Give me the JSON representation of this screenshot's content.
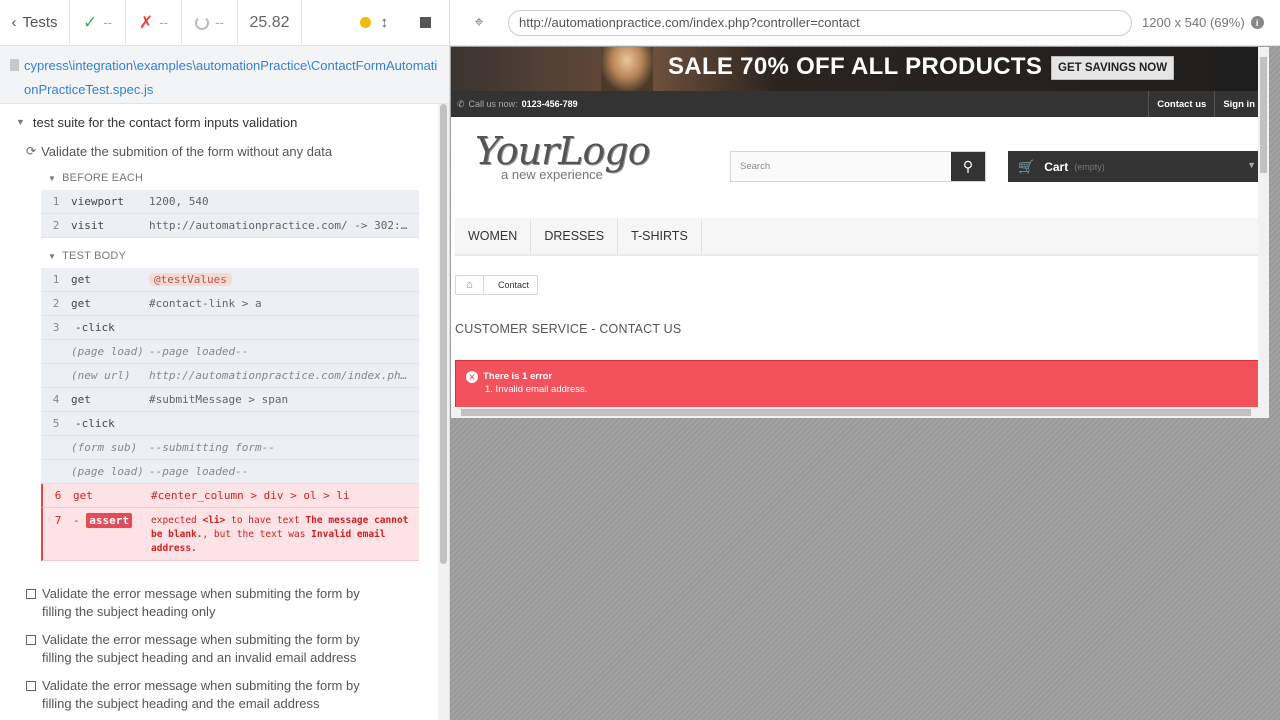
{
  "reporter": {
    "header": {
      "tests_label": "Tests",
      "passed": "--",
      "failed": "--",
      "pending": "--",
      "duration": "25.82"
    },
    "spec_path": "cypress\\integration\\examples\\automationPractice\\ContactFormAutomationPracticeTest.spec.js",
    "suite_title": "test suite for the contact form inputs validation",
    "active_test": {
      "title": "Validate the submition of the form without any data",
      "before_each_label": "BEFORE EACH",
      "test_body_label": "TEST BODY",
      "before_each": [
        {
          "num": "1",
          "name": "viewport",
          "msg": "1200, 540"
        },
        {
          "num": "2",
          "name": "visit",
          "msg": "http://automationpractice.com/ -> 302:..."
        }
      ],
      "body": [
        {
          "num": "1",
          "name": "get",
          "msg": "@testValues"
        },
        {
          "num": "2",
          "name": "get",
          "msg": "#contact-link > a"
        },
        {
          "num": "3",
          "name": "-click",
          "msg": ""
        },
        {
          "num": "",
          "name": "(page load)",
          "msg": "--page loaded--"
        },
        {
          "num": "",
          "name": "(new url)",
          "msg": "http://automationpractice.com/index.ph..."
        },
        {
          "num": "4",
          "name": "get",
          "msg": "#submitMessage > span"
        },
        {
          "num": "5",
          "name": "-click",
          "msg": ""
        },
        {
          "num": "",
          "name": "(form sub)",
          "msg": "--submitting form--"
        },
        {
          "num": "",
          "name": "(page load)",
          "msg": "--page loaded--"
        },
        {
          "num": "6",
          "name": "get",
          "msg": "#center_column > div > ol > li"
        }
      ],
      "assert": {
        "num": "7",
        "dash": "-",
        "badge": "assert",
        "p1": "expected ",
        "b1": "<li>",
        "p2": " to have text ",
        "b2": "The message cannot be blank.",
        "p3": ", but the text was ",
        "b3": "Invalid email address."
      }
    },
    "pending_tests": [
      "Validate the error message when submiting the form by filling the subject heading only",
      "Validate the error message when submiting the form by filling the subject heading and an invalid email address",
      "Validate the error message when submiting the form by filling the subject heading and the email address"
    ]
  },
  "aut": {
    "url": "http://automationpractice.com/index.php?controller=contact",
    "viewport_info": "1200 x 540",
    "zoom": "(69%)",
    "site": {
      "banner_text": "SALE 70% OFF ALL PRODUCTS",
      "banner_cta": "GET SAVINGS NOW",
      "call_label": "Call us now:",
      "phone": "0123-456-789",
      "contact_link": "Contact us",
      "signin_link": "Sign in",
      "logo_main": "YourLogo",
      "logo_sub": "a new experience",
      "search_placeholder": "Search",
      "cart_label": "Cart",
      "cart_state": "(empty)",
      "menu": [
        "Women",
        "Dresses",
        "T-shirts"
      ],
      "breadcrumb": "Contact",
      "page_heading": "Customer service - Contact us",
      "alert_title": "There is 1 error",
      "alert_item": "1. Invalid email address."
    }
  }
}
